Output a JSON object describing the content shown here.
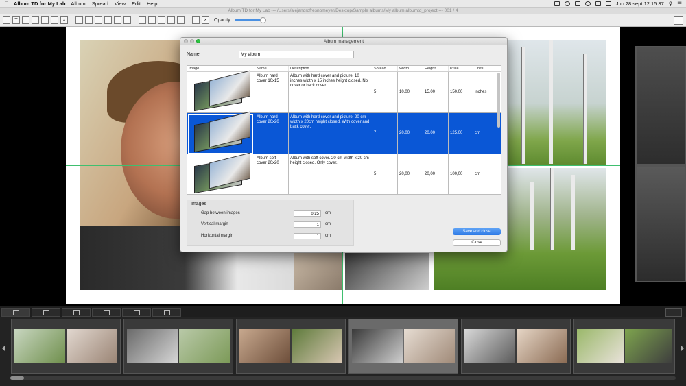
{
  "menubar": {
    "app_name": "Album TD for My Lab",
    "menus": [
      "Album",
      "Spread",
      "View",
      "Edit",
      "Help"
    ],
    "clock": "Jun 28 sept   12:15:37"
  },
  "window": {
    "title": "Album TD for My Lab --- /Users/alejandrofresnomeyer/Desktop/Sample albums/My album.albumtd_project --- 001 / 4"
  },
  "toolbar": {
    "opacity_label": "Opacity"
  },
  "dialog": {
    "title": "Album management",
    "name_label": "Name",
    "name_value": "My album",
    "columns": [
      "Image",
      "Name",
      "Description",
      "Spread",
      "Width",
      "Height",
      "Price",
      "Units"
    ],
    "rows": [
      {
        "name": "Album hard cover 10x15",
        "description": "Album with hard cover and picture. 10 inches width x 15 inches height closed. No cover or back cover.",
        "spread": "5",
        "width": "10,00",
        "height": "15,00",
        "price": "150,00",
        "units": "inches"
      },
      {
        "name": "Album hard cover 20x20",
        "description": "Album with hard cover and picture. 20 cm width x 20cm height closed. With cover and back cover.",
        "spread": "7",
        "width": "20,00",
        "height": "20,00",
        "price": "125,00",
        "units": "cm"
      },
      {
        "name": "Album soft cover 20x20",
        "description": "Album with soft cover. 20 cm width x 20 cm height closed. Only cover.",
        "spread": "5",
        "width": "20,00",
        "height": "20,00",
        "price": "100,00",
        "units": "cm"
      }
    ],
    "images_group": {
      "title": "Images",
      "gap_label": "Gap between images",
      "gap_value": "0,25",
      "gap_unit": "cm",
      "vmargin_label": "Vertical margin",
      "vmargin_value": "1",
      "vmargin_unit": "cm",
      "hmargin_label": "Horizontal margin",
      "hmargin_value": "1",
      "hmargin_unit": "cm"
    },
    "save_label": "Save and close",
    "close_label": "Close"
  },
  "colors": {
    "selection": "#0a57d6",
    "primary_button": "#2e7ae6",
    "guide": "#3fbf6f"
  }
}
